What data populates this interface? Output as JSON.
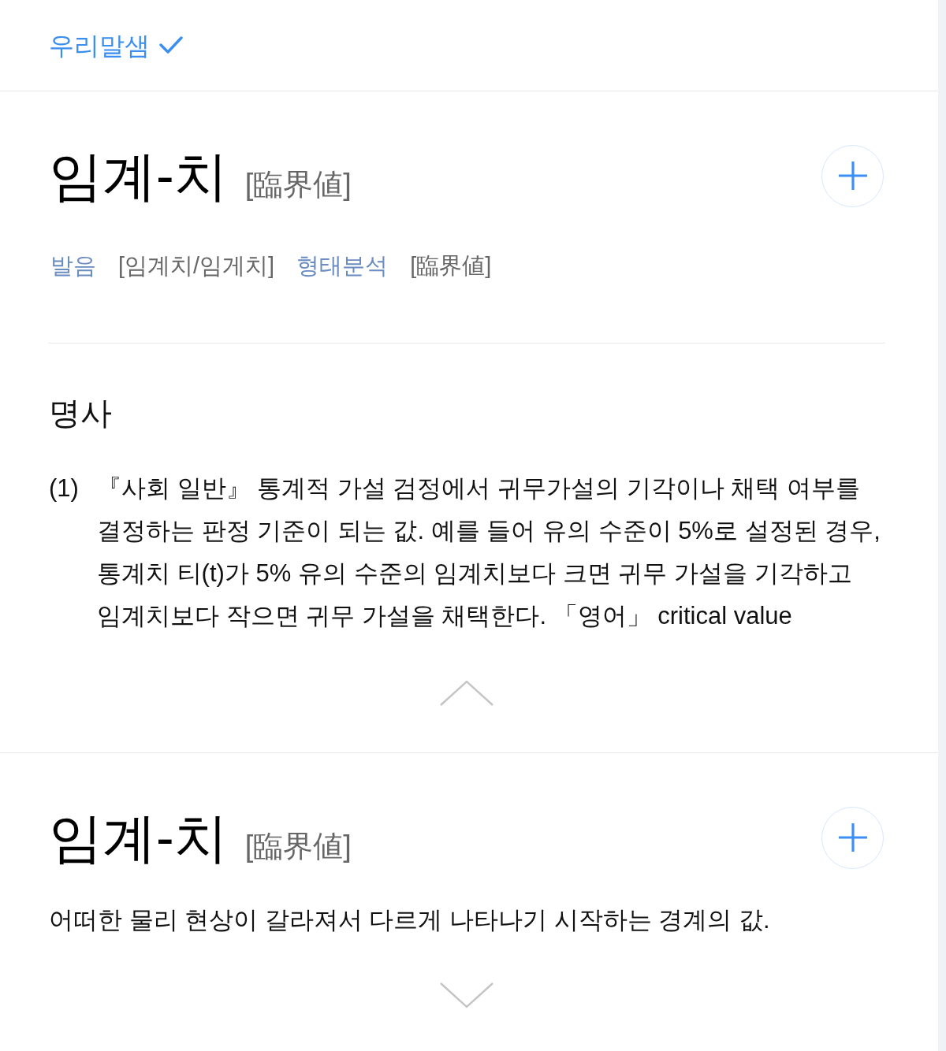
{
  "header": {
    "title": "우리말샘"
  },
  "entries": [
    {
      "headword": "임계-치",
      "hanja": "[臨界値]",
      "expanded": true,
      "details": [
        {
          "label": "발음",
          "value": "[임계치/임게치]"
        },
        {
          "label": "형태분석",
          "value": "[臨界値]"
        }
      ],
      "part_of_speech": "명사",
      "senses": [
        {
          "number": "(1)",
          "text": "『사회 일반』 통계적 가설 검정에서 귀무가설의 기각이나 채택 여부를 결정하는 판정 기준이 되는 값. 예를 들어 유의 수준이 5%로 설정된 경우, 통계치 티(t)가 5% 유의 수준의 임계치보다 크면 귀무 가설을 기각하고 임계치보다 작으면 귀무 가설을 채택한다. 「영어」 critical value"
        }
      ]
    },
    {
      "headword": "임계-치",
      "hanja": "[臨界値]",
      "expanded": false,
      "summary": "어떠한 물리 현상이 갈라져서 다르게 나타나기 시작하는 경계의 값."
    }
  ]
}
